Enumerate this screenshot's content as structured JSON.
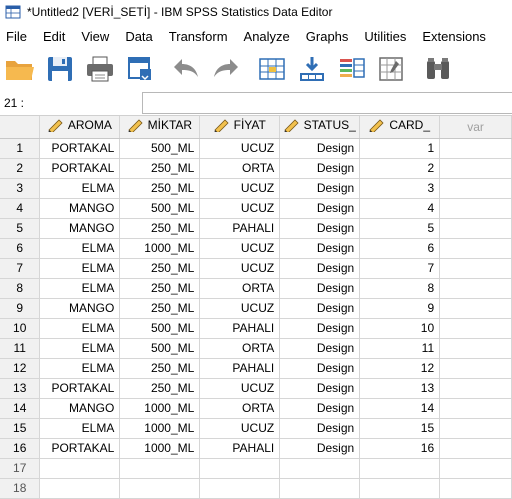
{
  "window": {
    "title": "*Untitled2 [VERİ_SETİ] - IBM SPSS Statistics Data Editor"
  },
  "menu": [
    "File",
    "Edit",
    "View",
    "Data",
    "Transform",
    "Analyze",
    "Graphs",
    "Utilities",
    "Extensions"
  ],
  "toolbar": [
    "open-folder-icon",
    "save-icon",
    "print-icon",
    "dialog-recall-icon",
    "undo-icon",
    "redo-icon",
    "goto-case-icon",
    "goto-variable-icon",
    "variables-icon",
    "find-icon",
    "binoculars-icon"
  ],
  "cell_editor": {
    "ref": "21 :",
    "value": ""
  },
  "columns": [
    {
      "label": "AROMA",
      "icon": "pencil-ruler-icon"
    },
    {
      "label": "MİKTAR",
      "icon": "pencil-ruler-icon"
    },
    {
      "label": "FİYAT",
      "icon": "pencil-ruler-icon"
    },
    {
      "label": "STATUS_",
      "icon": "pencil-ruler-icon"
    },
    {
      "label": "CARD_",
      "icon": "pencil-ruler-icon"
    },
    {
      "label": "var",
      "icon": ""
    }
  ],
  "rows": [
    {
      "n": "1",
      "cells": [
        "PORTAKAL",
        "500_ML",
        "UCUZ",
        "Design",
        "1"
      ]
    },
    {
      "n": "2",
      "cells": [
        "PORTAKAL",
        "250_ML",
        "ORTA",
        "Design",
        "2"
      ]
    },
    {
      "n": "3",
      "cells": [
        "ELMA",
        "250_ML",
        "UCUZ",
        "Design",
        "3"
      ]
    },
    {
      "n": "4",
      "cells": [
        "MANGO",
        "500_ML",
        "UCUZ",
        "Design",
        "4"
      ]
    },
    {
      "n": "5",
      "cells": [
        "MANGO",
        "250_ML",
        "PAHALI",
        "Design",
        "5"
      ]
    },
    {
      "n": "6",
      "cells": [
        "ELMA",
        "1000_ML",
        "UCUZ",
        "Design",
        "6"
      ]
    },
    {
      "n": "7",
      "cells": [
        "ELMA",
        "250_ML",
        "UCUZ",
        "Design",
        "7"
      ]
    },
    {
      "n": "8",
      "cells": [
        "ELMA",
        "250_ML",
        "ORTA",
        "Design",
        "8"
      ]
    },
    {
      "n": "9",
      "cells": [
        "MANGO",
        "250_ML",
        "UCUZ",
        "Design",
        "9"
      ]
    },
    {
      "n": "10",
      "cells": [
        "ELMA",
        "500_ML",
        "PAHALI",
        "Design",
        "10"
      ]
    },
    {
      "n": "11",
      "cells": [
        "ELMA",
        "500_ML",
        "ORTA",
        "Design",
        "11"
      ]
    },
    {
      "n": "12",
      "cells": [
        "ELMA",
        "250_ML",
        "PAHALI",
        "Design",
        "12"
      ]
    },
    {
      "n": "13",
      "cells": [
        "PORTAKAL",
        "250_ML",
        "UCUZ",
        "Design",
        "13"
      ]
    },
    {
      "n": "14",
      "cells": [
        "MANGO",
        "1000_ML",
        "ORTA",
        "Design",
        "14"
      ]
    },
    {
      "n": "15",
      "cells": [
        "ELMA",
        "1000_ML",
        "UCUZ",
        "Design",
        "15"
      ]
    },
    {
      "n": "16",
      "cells": [
        "PORTAKAL",
        "1000_ML",
        "PAHALI",
        "Design",
        "16"
      ]
    },
    {
      "n": "17",
      "cells": [
        "",
        "",
        "",
        "",
        ""
      ]
    },
    {
      "n": "18",
      "cells": [
        "",
        "",
        "",
        "",
        ""
      ]
    }
  ]
}
